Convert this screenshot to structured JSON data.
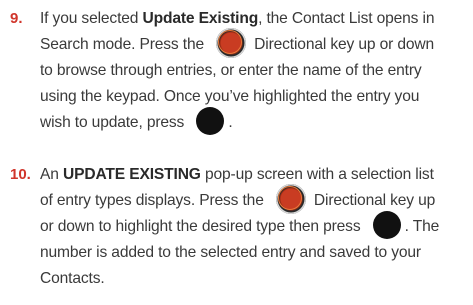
{
  "steps": [
    {
      "number": "9.",
      "lines": [
        [
          "If you selected ",
          "Update Existing",
          ", the Contact List opens in"
        ],
        [
          "Search mode. Press the ",
          "Directional key up or down"
        ],
        [
          "to browse through entries, or enter the name of the entry"
        ],
        [
          "using the keypad. Once you’ve highlighted the entry you"
        ],
        [
          "wish to update, press ",
          "."
        ]
      ]
    },
    {
      "number": "10.",
      "lines": [
        [
          "An ",
          "UPDATE EXISTING",
          " pop-up screen with a selection list"
        ],
        [
          "of entry types displays. Press the ",
          "Directional key up"
        ],
        [
          "or down to highlight the desired type then press ",
          ". The"
        ],
        [
          "number is added to the selected entry and saved to your"
        ],
        [
          "Contacts."
        ]
      ]
    }
  ],
  "icons": {
    "directional_key": "directional-key-icon",
    "ok_key": "ok-key-icon"
  }
}
